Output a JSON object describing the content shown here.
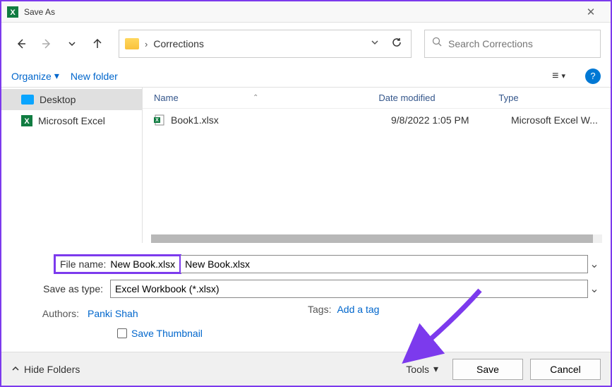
{
  "window": {
    "title": "Save As"
  },
  "navigation": {
    "breadcrumb": "Corrections"
  },
  "search": {
    "placeholder": "Search Corrections"
  },
  "toolbar": {
    "organize_label": "Organize",
    "new_folder_label": "New folder"
  },
  "sidebar": {
    "items": [
      {
        "label": "Desktop",
        "icon": "desktop",
        "selected": true
      },
      {
        "label": "Microsoft Excel",
        "icon": "excel",
        "selected": false
      }
    ]
  },
  "columns": {
    "name": "Name",
    "date": "Date modified",
    "type": "Type"
  },
  "files": [
    {
      "name": "Book1.xlsx",
      "date": "9/8/2022 1:05 PM",
      "type": "Microsoft Excel W..."
    }
  ],
  "form": {
    "filename_label": "File name:",
    "filename_value": "New Book.xlsx",
    "savetype_label": "Save as type:",
    "savetype_value": "Excel Workbook (*.xlsx)",
    "authors_label": "Authors:",
    "authors_value": "Panki Shah",
    "tags_label": "Tags:",
    "tags_value": "Add a tag",
    "thumbnail_label": "Save Thumbnail"
  },
  "footer": {
    "hide_folders_label": "Hide Folders",
    "tools_label": "Tools",
    "save_label": "Save",
    "cancel_label": "Cancel"
  },
  "annotation": {
    "highlight_color": "#7c3aed"
  }
}
